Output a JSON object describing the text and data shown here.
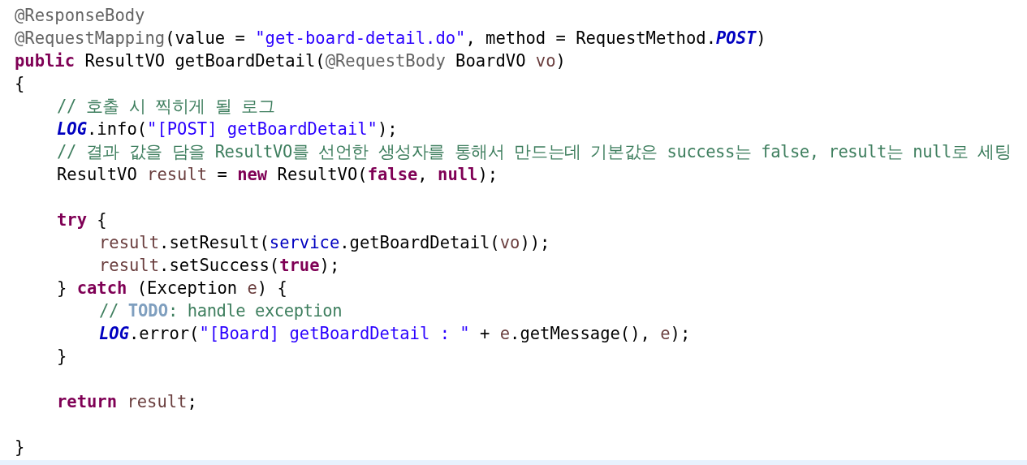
{
  "editor": {
    "lines": [
      {
        "kind": "code",
        "tokens": [
          {
            "kind": "annotation",
            "text": "@ResponseBody"
          }
        ]
      },
      {
        "kind": "code",
        "tokens": [
          {
            "kind": "annotation",
            "text": "@RequestMapping"
          },
          {
            "kind": "plain",
            "text": "(value = "
          },
          {
            "kind": "string",
            "text": "\"get-board-detail.do\""
          },
          {
            "kind": "plain",
            "text": ", method = RequestMethod."
          },
          {
            "kind": "static",
            "text": "POST"
          },
          {
            "kind": "plain",
            "text": ")"
          }
        ]
      },
      {
        "kind": "code",
        "tokens": [
          {
            "kind": "keyword",
            "text": "public"
          },
          {
            "kind": "plain",
            "text": " ResultVO getBoardDetail("
          },
          {
            "kind": "annotation",
            "text": "@RequestBody"
          },
          {
            "kind": "plain",
            "text": " BoardVO "
          },
          {
            "kind": "local",
            "text": "vo"
          },
          {
            "kind": "plain",
            "text": ")"
          }
        ]
      },
      {
        "kind": "code",
        "tokens": [
          {
            "kind": "plain",
            "text": "{"
          }
        ],
        "children": [
          {
            "kind": "code",
            "tokens": [
              {
                "kind": "comment",
                "text": "// 호출 시 찍히게 될 로그"
              }
            ]
          },
          {
            "kind": "code",
            "tokens": [
              {
                "kind": "static",
                "text": "LOG"
              },
              {
                "kind": "plain",
                "text": ".info("
              },
              {
                "kind": "string",
                "text": "\"[POST] getBoardDetail\""
              },
              {
                "kind": "plain",
                "text": ");"
              }
            ]
          },
          {
            "kind": "code",
            "tokens": [
              {
                "kind": "comment",
                "text": "// 결과 값을 담을 ResultVO를 선언한 생성자를 통해서 만드는데 기본값은 success는 false, result는 null로 세팅"
              }
            ]
          },
          {
            "kind": "code",
            "tokens": [
              {
                "kind": "plain",
                "text": "ResultVO "
              },
              {
                "kind": "local",
                "text": "result"
              },
              {
                "kind": "plain",
                "text": " = "
              },
              {
                "kind": "keyword",
                "text": "new"
              },
              {
                "kind": "plain",
                "text": " ResultVO("
              },
              {
                "kind": "keyword",
                "text": "false"
              },
              {
                "kind": "plain",
                "text": ", "
              },
              {
                "kind": "keyword",
                "text": "null"
              },
              {
                "kind": "plain",
                "text": ");"
              }
            ]
          },
          {
            "kind": "blank"
          },
          {
            "kind": "code",
            "tokens": [
              {
                "kind": "keyword",
                "text": "try"
              },
              {
                "kind": "plain",
                "text": " {"
              }
            ],
            "children": [
              {
                "kind": "code",
                "tokens": [
                  {
                    "kind": "local",
                    "text": "result"
                  },
                  {
                    "kind": "plain",
                    "text": ".setResult("
                  },
                  {
                    "kind": "field",
                    "text": "service"
                  },
                  {
                    "kind": "plain",
                    "text": ".getBoardDetail("
                  },
                  {
                    "kind": "local",
                    "text": "vo"
                  },
                  {
                    "kind": "plain",
                    "text": "));"
                  }
                ]
              },
              {
                "kind": "code",
                "tokens": [
                  {
                    "kind": "local",
                    "text": "result"
                  },
                  {
                    "kind": "plain",
                    "text": ".setSuccess("
                  },
                  {
                    "kind": "keyword",
                    "text": "true"
                  },
                  {
                    "kind": "plain",
                    "text": ");"
                  }
                ]
              }
            ]
          },
          {
            "kind": "code",
            "tokens": [
              {
                "kind": "plain",
                "text": "} "
              },
              {
                "kind": "keyword",
                "text": "catch"
              },
              {
                "kind": "plain",
                "text": " (Exception "
              },
              {
                "kind": "local",
                "text": "e"
              },
              {
                "kind": "plain",
                "text": ") {"
              }
            ],
            "children": [
              {
                "kind": "code",
                "tokens": [
                  {
                    "kind": "comment",
                    "text": "// "
                  },
                  {
                    "kind": "todo",
                    "text": "TODO"
                  },
                  {
                    "kind": "comment",
                    "text": ": handle exception"
                  }
                ]
              },
              {
                "kind": "code",
                "tokens": [
                  {
                    "kind": "static",
                    "text": "LOG"
                  },
                  {
                    "kind": "plain",
                    "text": ".error("
                  },
                  {
                    "kind": "string",
                    "text": "\"[Board] getBoardDetail : \""
                  },
                  {
                    "kind": "plain",
                    "text": " + "
                  },
                  {
                    "kind": "local",
                    "text": "e"
                  },
                  {
                    "kind": "plain",
                    "text": ".getMessage(), "
                  },
                  {
                    "kind": "local",
                    "text": "e"
                  },
                  {
                    "kind": "plain",
                    "text": ");"
                  }
                ]
              }
            ]
          },
          {
            "kind": "code",
            "tokens": [
              {
                "kind": "plain",
                "text": "}"
              }
            ]
          },
          {
            "kind": "blank"
          },
          {
            "kind": "code",
            "tokens": [
              {
                "kind": "keyword",
                "text": "return"
              },
              {
                "kind": "local",
                "text": " result"
              },
              {
                "kind": "plain",
                "text": ";"
              }
            ]
          },
          {
            "kind": "blank"
          }
        ]
      },
      {
        "kind": "code",
        "tokens": [
          {
            "kind": "plain",
            "text": "}"
          }
        ]
      }
    ]
  }
}
